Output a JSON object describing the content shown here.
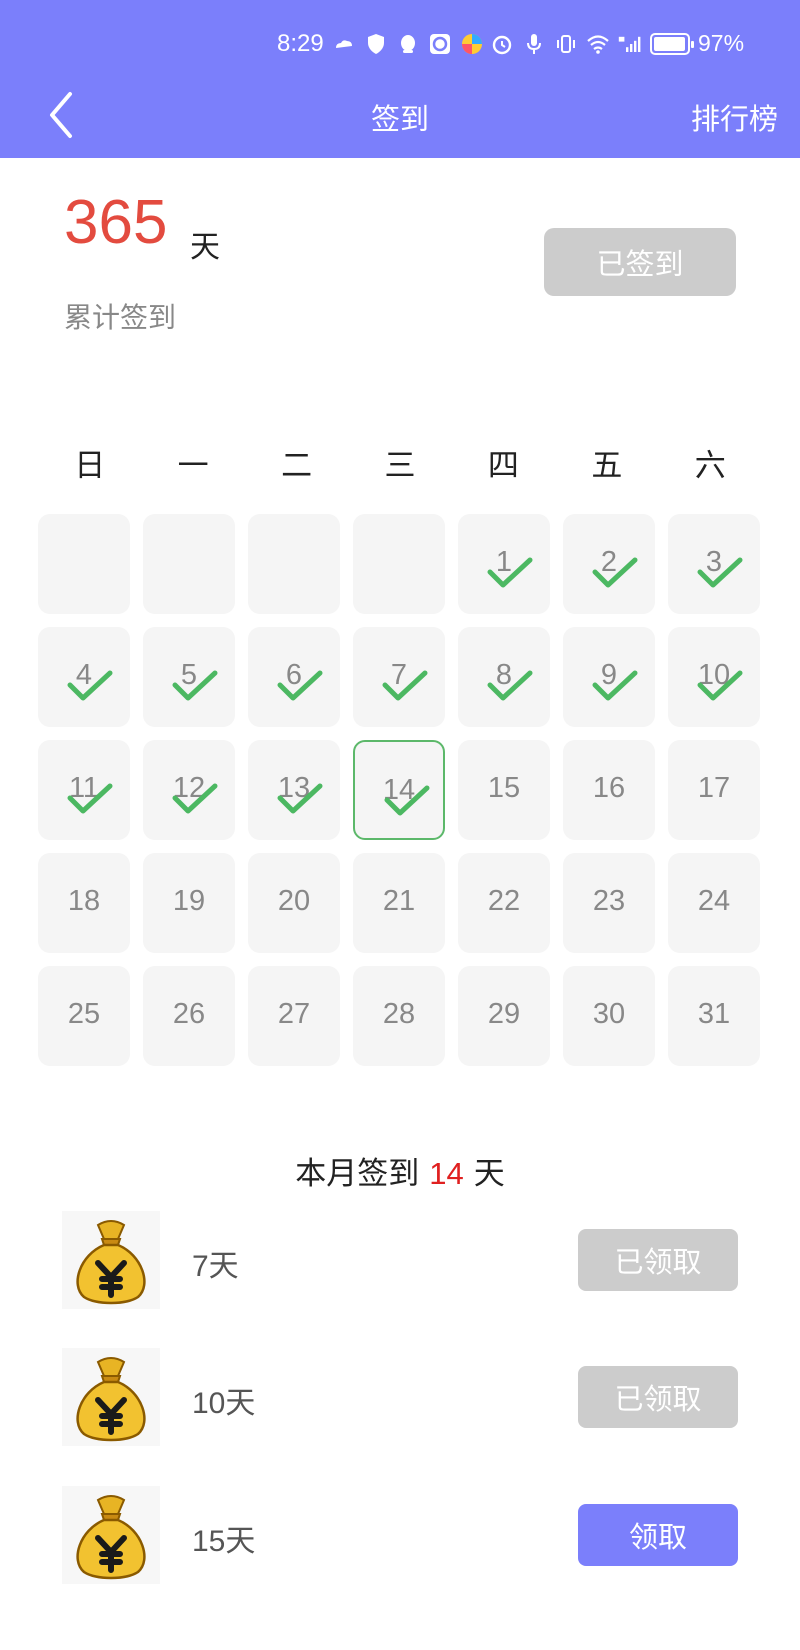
{
  "status_bar": {
    "time": "8:29",
    "battery_percent": "97%",
    "battery_level": 0.97
  },
  "header": {
    "title": "签到",
    "right_link": "排行榜",
    "back_icon": "chevron-left-icon"
  },
  "summary": {
    "total_days": "365",
    "unit": "天",
    "label": "累计签到",
    "button_label": "已签到"
  },
  "weekdays": [
    "日",
    "一",
    "二",
    "三",
    "四",
    "五",
    "六"
  ],
  "calendar": {
    "leading_blanks": 4,
    "days": [
      "1",
      "2",
      "3",
      "4",
      "5",
      "6",
      "7",
      "8",
      "9",
      "10",
      "11",
      "12",
      "13",
      "14",
      "15",
      "16",
      "17",
      "18",
      "19",
      "20",
      "21",
      "22",
      "23",
      "24",
      "25",
      "26",
      "27",
      "28",
      "29",
      "30",
      "31"
    ],
    "checked_through": 14,
    "today": 14
  },
  "month_summary": {
    "prefix": "本月签到",
    "count": "14",
    "suffix": "天"
  },
  "rewards": [
    {
      "label": "7天",
      "button": "已领取",
      "state": "done"
    },
    {
      "label": "10天",
      "button": "已领取",
      "state": "done"
    },
    {
      "label": "15天",
      "button": "领取",
      "state": "claim"
    }
  ],
  "colors": {
    "accent": "#7b7ffb",
    "total_red": "#e34b3f",
    "month_red": "#e02020",
    "check_green": "#4cb862",
    "disabled_gray": "#cccccc"
  }
}
